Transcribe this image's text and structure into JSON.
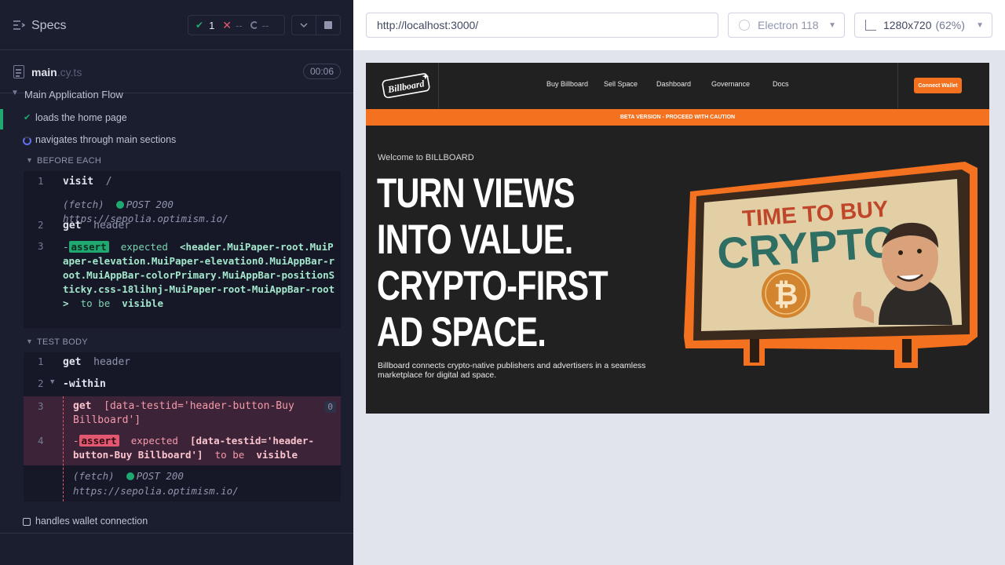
{
  "runner": {
    "specs_label": "Specs",
    "stats": {
      "passed": "1",
      "failed": "--",
      "pending": "--"
    },
    "spec_file": {
      "name": "main",
      "ext": ".cy.ts",
      "duration": "00:06"
    },
    "suite_title": "Main Application Flow",
    "tests": [
      {
        "label": "loads the home page",
        "state": "passed"
      },
      {
        "label": "navigates through main sections",
        "state": "running"
      },
      {
        "label": "handles wallet connection",
        "state": "pending"
      }
    ],
    "before_each": {
      "label": "BEFORE EACH",
      "commands": [
        {
          "num": "1",
          "name": "visit",
          "arg": "/"
        },
        {
          "method": "(fetch)",
          "request": "POST 200 https://sepolia.optimism.io/"
        },
        {
          "num": "2",
          "name": "get",
          "arg": "header"
        },
        {
          "num": "3",
          "prefix": "-",
          "name": "assert",
          "pre": "expected",
          "selector": "<header.MuiPaper-root.MuiPaper-elevation.MuiPaper-elevation0.MuiAppBar-root.MuiAppBar-colorPrimary.MuiAppBar-positionSticky.css-18lihnj-MuiPaper-root-MuiAppBar-root>",
          "mid": "to be",
          "post": "visible"
        }
      ]
    },
    "test_body": {
      "label": "TEST BODY",
      "commands": [
        {
          "num": "1",
          "name": "get",
          "arg": "header"
        },
        {
          "num": "2",
          "name": "-within"
        },
        {
          "num": "3",
          "name": "get",
          "arg": "[data-testid='header-button-Buy Billboard']",
          "count": "0"
        },
        {
          "num": "4",
          "prefix": "-",
          "name": "assert",
          "pre": "expected",
          "selector": "[data-testid='header-button-Buy Billboard']",
          "mid": "to be",
          "post": "visible"
        },
        {
          "method": "(fetch)",
          "request": "POST 200",
          "url": "https://sepolia.optimism.io/"
        }
      ]
    }
  },
  "topbar": {
    "url": "http://localhost:3000/",
    "browser": "Electron 118",
    "viewport": "1280x720",
    "zoom": "(62%)"
  },
  "app": {
    "logo_text": "Billboard",
    "nav": [
      "Buy Billboard",
      "Sell Space",
      "Dashboard",
      "Governance",
      "Docs"
    ],
    "connect_label": "Connect Wallet",
    "beta_banner": "BETA VERSION - PROCEED WITH CAUTION",
    "welcome": "Welcome to BILLBOARD",
    "hero_lines": [
      "TURN VIEWS",
      "INTO VALUE.",
      "CRYPTO-FIRST",
      "AD SPACE."
    ],
    "subtitle": "Billboard connects crypto-native publishers and advertisers in a seamless marketplace for digital ad space.",
    "billboard": {
      "line1": "TIME TO BUY",
      "line2": "CRYPTO!"
    }
  },
  "colors": {
    "pass": "#1fa971",
    "fail": "#e45770",
    "running": "#6470f3",
    "brand_orange": "#f3711f",
    "app_bg": "#212121",
    "runner_bg": "#1b1e2e"
  },
  "icons": [
    "specs-icon",
    "check-icon",
    "x-icon",
    "spinner-icon",
    "chevron-down-icon",
    "stop-icon",
    "file-icon",
    "electron-icon",
    "viewport-icon",
    "bitcoin-icon"
  ]
}
